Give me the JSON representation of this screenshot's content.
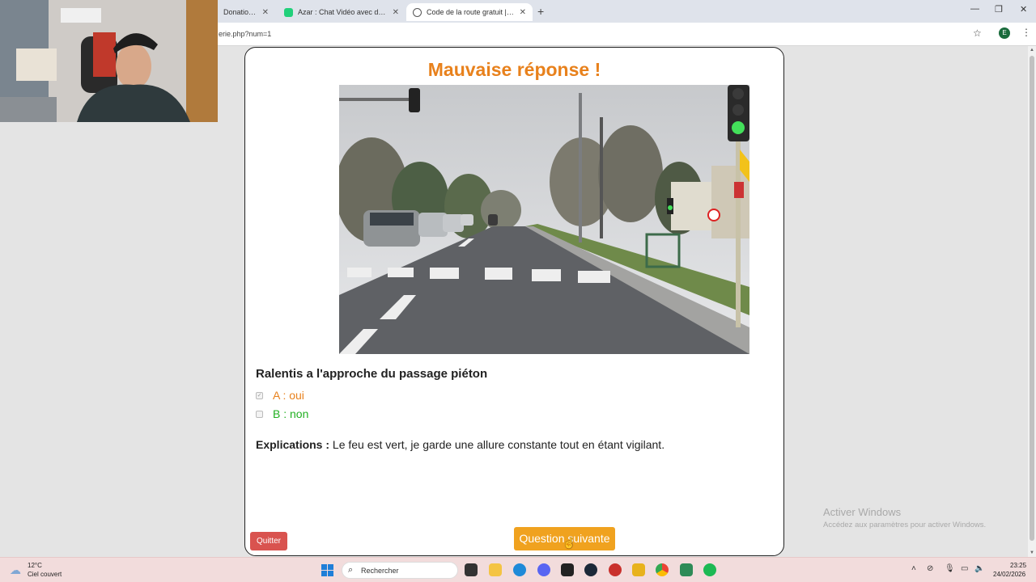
{
  "browser": {
    "tabs": [
      {
        "title": "DonationAle"
      },
      {
        "title": "Azar : Chat Vidéo avec de nouv"
      },
      {
        "title": "Code de la route gratuit | Révis"
      }
    ],
    "url": "erie.php?num=1",
    "profile_initial": "E"
  },
  "quiz": {
    "result_title": "Mauvaise réponse !",
    "question": "Ralentis a l'approche du passage piéton",
    "answers": [
      {
        "label": "A : oui",
        "checked": true,
        "color": "#e8811c"
      },
      {
        "label": "B : non",
        "checked": false,
        "color": "#22b022"
      }
    ],
    "explication_label": "Explications :",
    "explication_text": " Le feu est vert, je garde une allure constante tout en étant vigilant.",
    "quit_label": "Quitter",
    "next_label": "Question suivante"
  },
  "watermark": {
    "line1": "Activer Windows",
    "line2": "Accédez aux paramètres pour activer Windows."
  },
  "taskbar": {
    "temperature": "12°C",
    "weather": "Ciel couvert",
    "search_placeholder": "Rechercher",
    "time": "23:25",
    "date": "24/02/2026"
  },
  "colors": {
    "accent_orange": "#e8811c",
    "correct_green": "#22b022",
    "quit_red": "#d9534f",
    "next_button": "#f0a21f"
  }
}
